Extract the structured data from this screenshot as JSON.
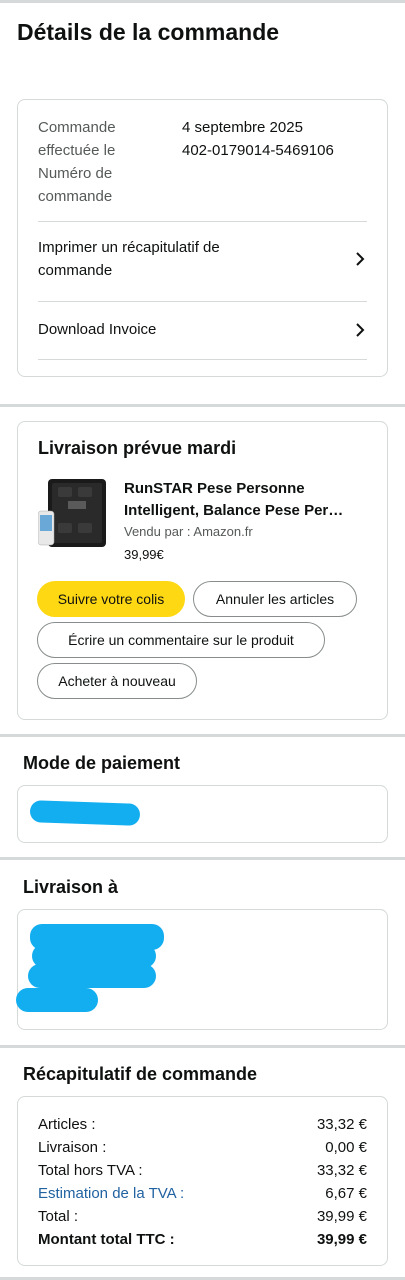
{
  "page_title": "Détails de la commande",
  "order_info": {
    "labels": [
      "Commande",
      "effectuée le",
      "Numéro de",
      "commande"
    ],
    "date": "4 septembre 2025",
    "order_number": "402-0179014-5469106",
    "print_summary_label": "Imprimer un récapitulatif de commande",
    "download_invoice_label": "Download Invoice"
  },
  "delivery": {
    "title": "Livraison prévue mardi",
    "product_name_line1": "RunSTAR Pese Personne",
    "product_name_line2": "Intelligent, Balance Pese Per…",
    "sold_by_label": "Vendu par",
    "seller": ": Amazon.fr",
    "price": "39,99€",
    "buttons": {
      "track": "Suivre votre colis",
      "cancel": "Annuler les articles",
      "review": "Écrire un commentaire sur le produit",
      "buy_again": "Acheter à nouveau"
    }
  },
  "payment": {
    "title": "Mode de paiement"
  },
  "shipping": {
    "title": "Livraison à"
  },
  "summary": {
    "title": "Récapitulatif de commande",
    "rows": [
      {
        "label": "Articles :",
        "value": "33,32 €"
      },
      {
        "label": "Livraison :",
        "value": "0,00 €"
      },
      {
        "label": "Total hors TVA :",
        "value": "33,32 €"
      },
      {
        "label": "Estimation de la TVA :",
        "value": "6,67 €"
      },
      {
        "label": "Total :",
        "value": "39,99 €"
      },
      {
        "label": "Montant total TTC :",
        "value": "39,99 €"
      }
    ]
  },
  "colors": {
    "primary_button": "#ffd814",
    "link": "#2162a1",
    "redaction": "#12aef0",
    "border": "#d5d9d9"
  }
}
